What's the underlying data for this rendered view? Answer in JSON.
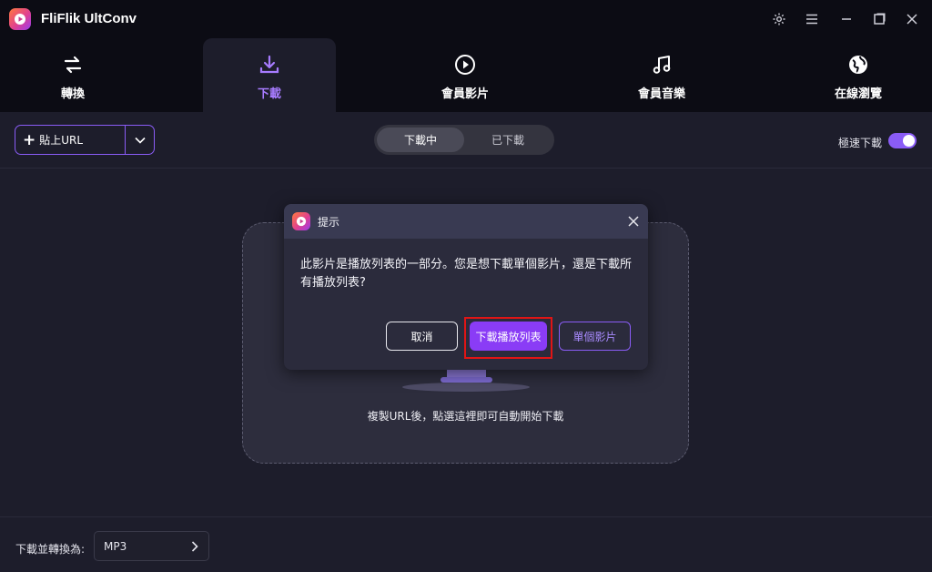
{
  "app": {
    "title": "FliFlik UltConv",
    "logo_icon": "play-logo-icon"
  },
  "window_controls": [
    "settings-icon",
    "menu-icon",
    "minimize-icon",
    "maximize-icon",
    "close-icon"
  ],
  "nav": {
    "active": "下載",
    "tabs": [
      {
        "label": "轉換",
        "icon": "convert-arrows-icon"
      },
      {
        "label": "下載",
        "icon": "download-icon"
      },
      {
        "label": "會員影片",
        "icon": "play-circle-icon"
      },
      {
        "label": "會員音樂",
        "icon": "music-note-icon"
      },
      {
        "label": "在線瀏覽",
        "icon": "globe-icon"
      }
    ]
  },
  "toolbar": {
    "paste_url_label": "貼上URL",
    "segments": [
      {
        "label": "下載中",
        "active": true
      },
      {
        "label": "已下載",
        "active": false
      }
    ],
    "turbo_label": "極速下載",
    "turbo_enabled": true
  },
  "dropzone": {
    "hint": "複製URL後，點選這裡即可自動開始下載"
  },
  "bottom": {
    "convert_label": "下載並轉換為:",
    "format_value": "MP3"
  },
  "dialog": {
    "title": "提示",
    "message": "此影片是播放列表的一部分。您是想下載單個影片，還是下載所有播放列表?",
    "cancel_label": "取消",
    "playlist_label": "下載播放列表",
    "single_label": "單個影片"
  },
  "colors": {
    "accent": "#8a5cf6",
    "primary_button": "#8a3cf6",
    "highlight": "#e01515",
    "background": "#1d1d2b"
  }
}
